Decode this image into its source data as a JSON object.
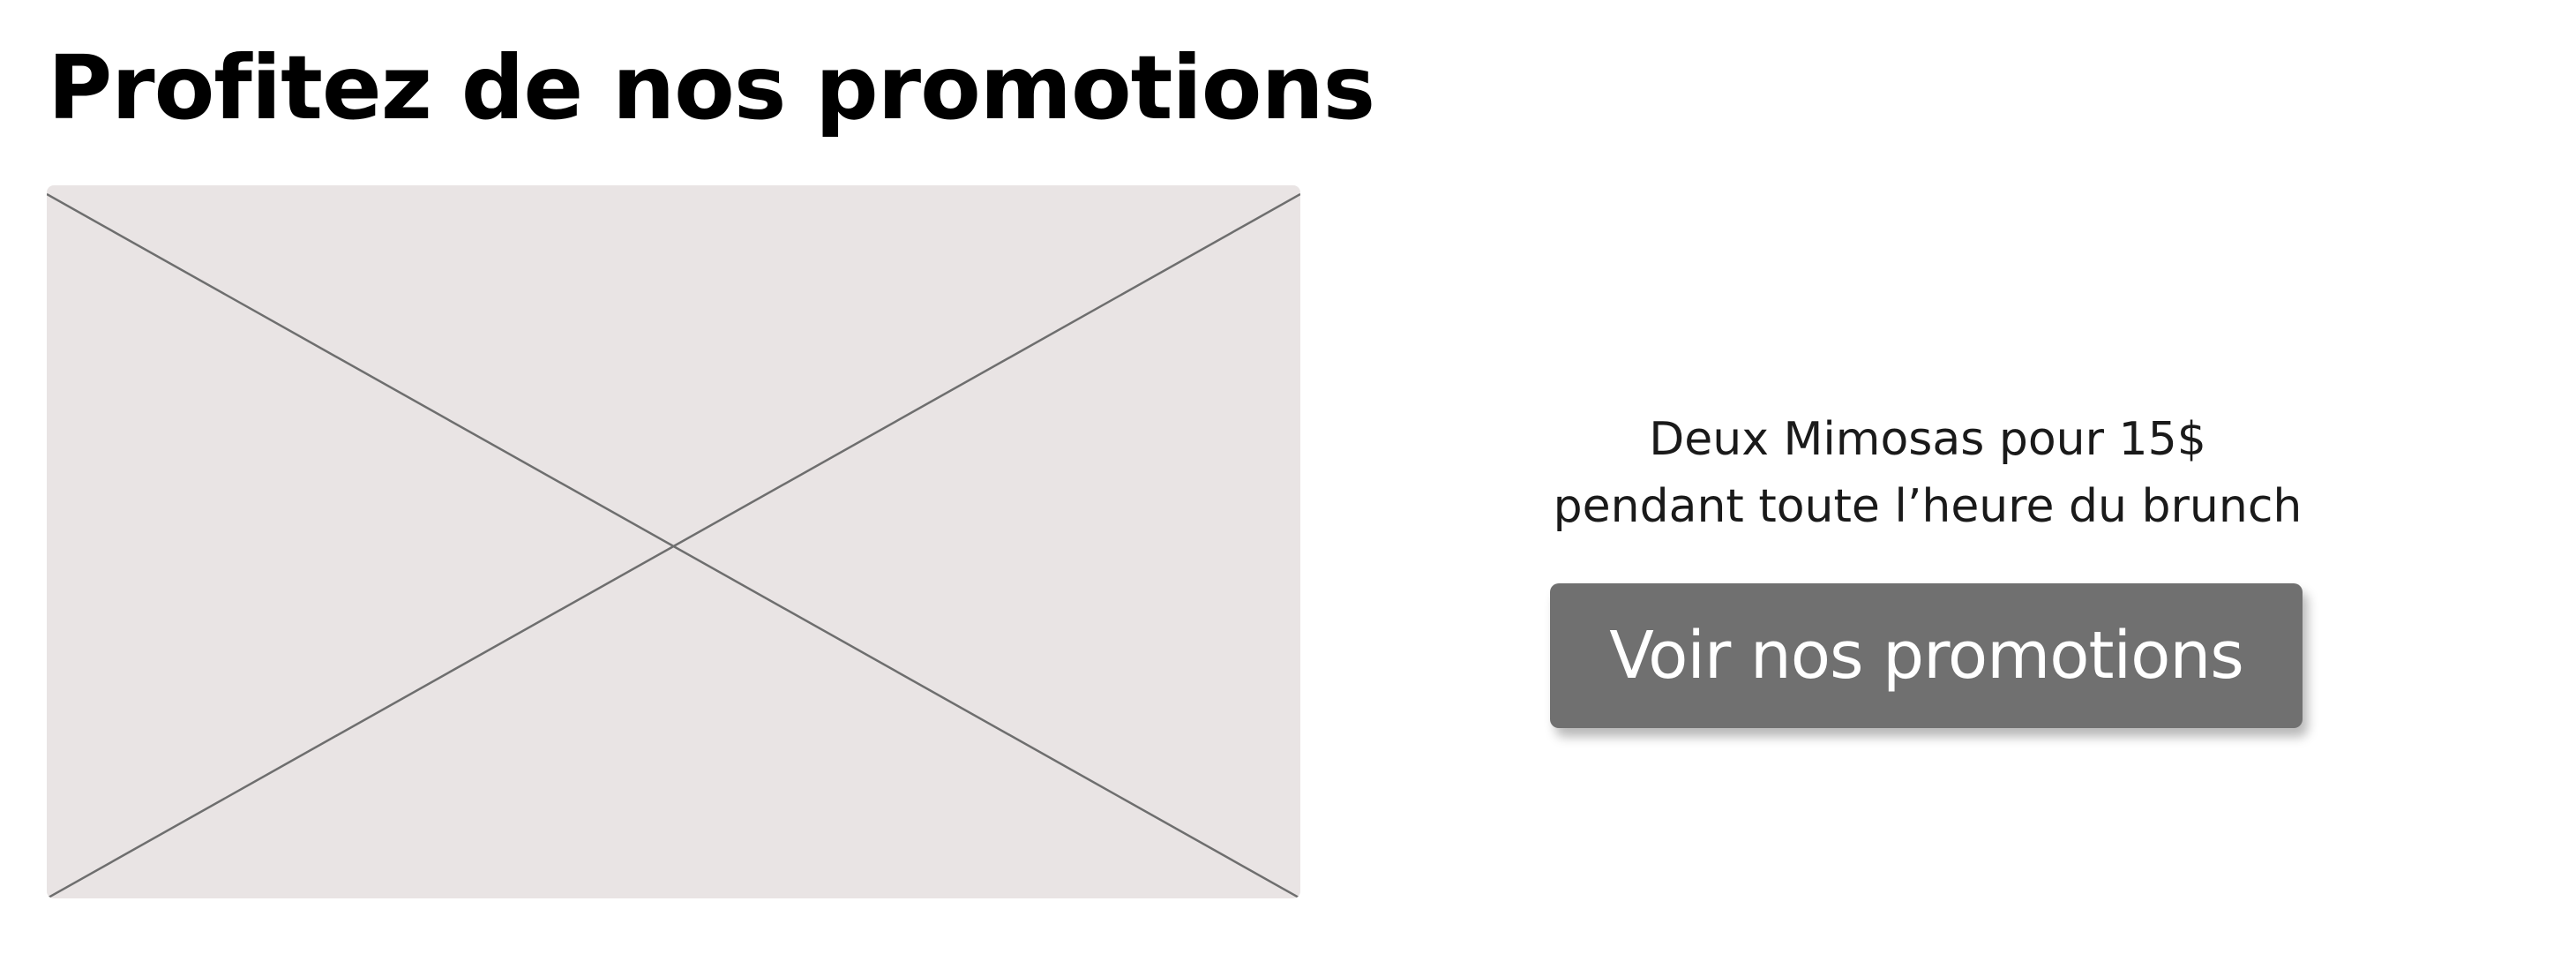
{
  "header": {
    "title": "Profitez de nos promotions"
  },
  "image_placeholder": {
    "icon": "image-placeholder-cross-icon",
    "fill_color": "#E9E4E4",
    "line_color": "#6E6E6E"
  },
  "promo": {
    "line_1": "Deux Mimosas pour 15$",
    "line_2": "pendant toute l’heure du brunch",
    "button_label": "Voir nos promotions",
    "button_color": "#707070",
    "button_text_color": "#FFFFFF"
  }
}
